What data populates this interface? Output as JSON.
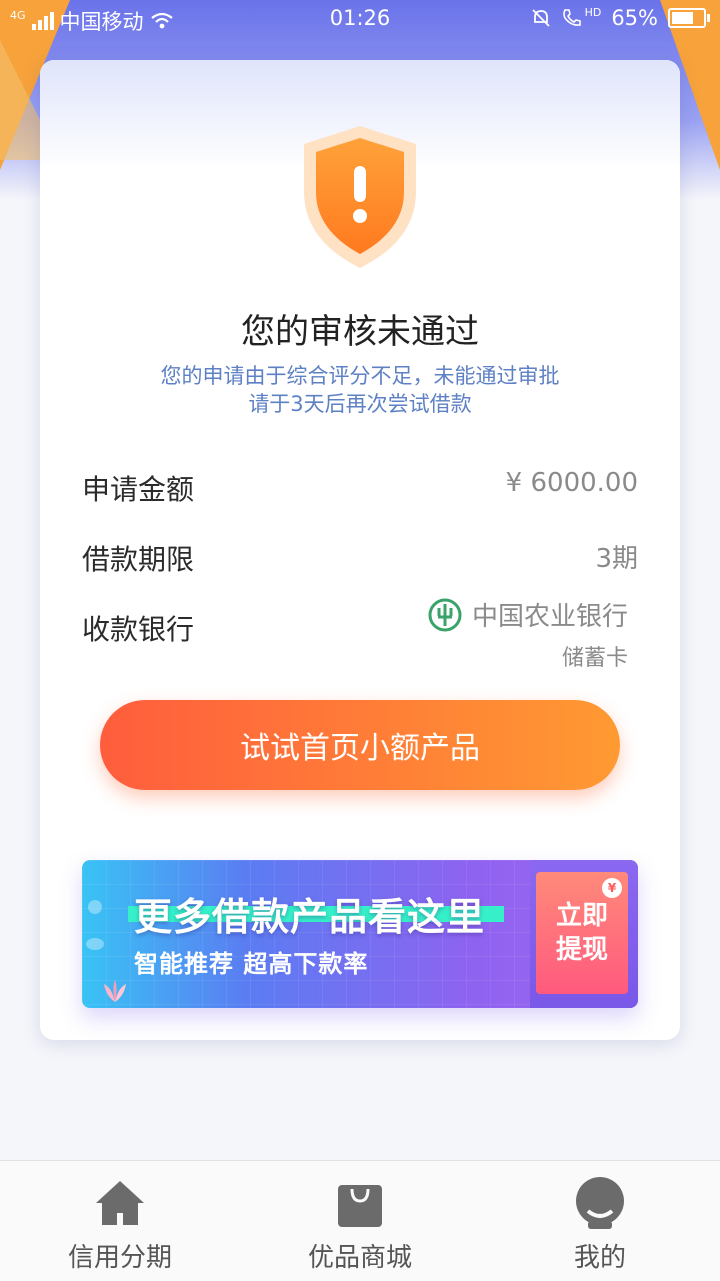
{
  "status_bar": {
    "network": "4G",
    "carrier": "中国移动",
    "time": "01:26",
    "hd": "HD",
    "battery": "65%"
  },
  "result": {
    "title": "您的审核未通过",
    "message_line1": "您的申请由于综合评分不足，未能通过审批",
    "message_line2": "请于3天后再次尝试借款"
  },
  "details": [
    {
      "label": "申请金额",
      "value": "¥ 6000.00"
    },
    {
      "label": "借款期限",
      "value": "3期"
    },
    {
      "label": "收款银行",
      "value": "中国农业银行",
      "sub": "储蓄卡",
      "icon": "abc-bank-icon"
    }
  ],
  "cta_button": {
    "label": "试试首页小额产品"
  },
  "banner": {
    "title": "更多借款产品看这里",
    "subtitle": "智能推荐 超高下款率",
    "action_label": "立即\n提现",
    "action_line1": "立即",
    "action_line2": "提现",
    "coin_symbol": "¥"
  },
  "tabbar": [
    {
      "label": "信用分期",
      "icon": "home-icon"
    },
    {
      "label": "优品商城",
      "icon": "shopping-bag-icon"
    },
    {
      "label": "我的",
      "icon": "profile-icon"
    }
  ],
  "colors": {
    "accent_orange": "#ff7a36",
    "subtitle_blue": "#5e80c4",
    "bank_green": "#3aa36a"
  }
}
